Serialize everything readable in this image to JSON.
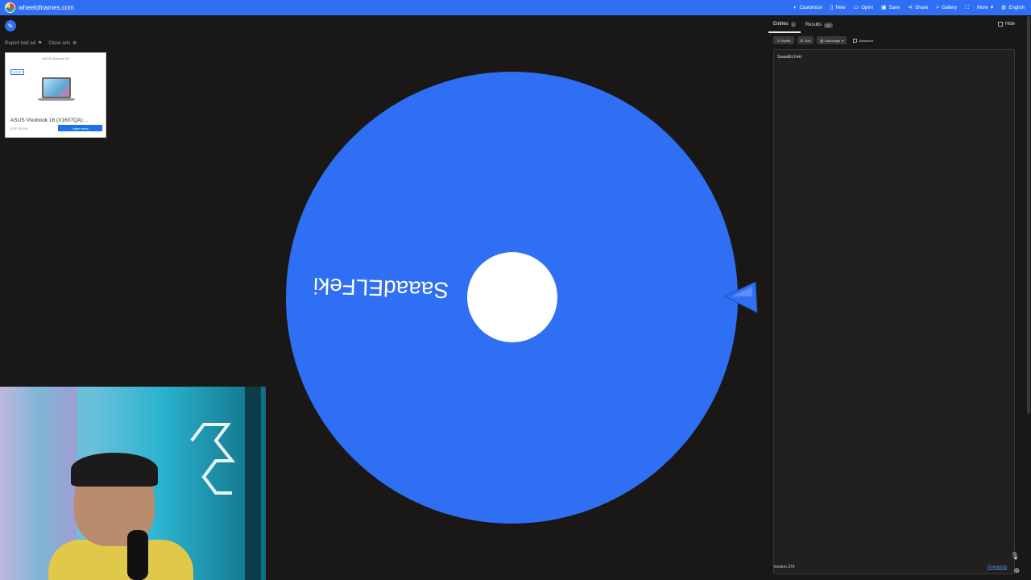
{
  "header": {
    "site_name": "wheelofnames.com",
    "menu": [
      {
        "label": "Customize",
        "icon": "palette-icon"
      },
      {
        "label": "New",
        "icon": "file-icon"
      },
      {
        "label": "Open",
        "icon": "folder-icon"
      },
      {
        "label": "Save",
        "icon": "save-icon"
      },
      {
        "label": "Share",
        "icon": "share-icon"
      },
      {
        "label": "Gallery",
        "icon": "search-icon"
      },
      {
        "label": "",
        "icon": "fullscreen-icon"
      },
      {
        "label": "More",
        "icon": "chevron-down-icon"
      },
      {
        "label": "English",
        "icon": "globe-icon"
      }
    ]
  },
  "ad": {
    "report_label": "Report bad ad",
    "close_label": "Close ads",
    "title": "ASUS Vivobook 16 (X1607QA):...",
    "cta": "Learn more",
    "brand_line": "ASUS vivobook 16",
    "discount_tag": "% OFF",
    "price_line": "EGP 39,299"
  },
  "wheel": {
    "entry_label": "SaaadELFeki",
    "color": "#2f6ff3"
  },
  "panel": {
    "tabs": [
      {
        "label": "Entries",
        "count": "1"
      },
      {
        "label": "Results",
        "count": "237"
      }
    ],
    "hide_label": "Hide",
    "toolbar": {
      "shuffle": "Shuffle",
      "sort": "Sort",
      "add_image": "Add image",
      "advanced": "Advanced"
    },
    "entries_text": "SaaadELFeki",
    "version": "Version 379",
    "changelog": "Changelog"
  }
}
